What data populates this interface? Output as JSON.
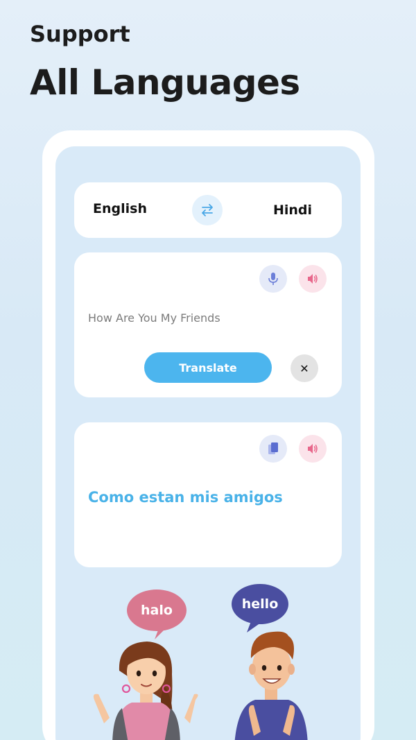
{
  "headline": {
    "subtitle": "Support",
    "title": "All Languages"
  },
  "language_selector": {
    "source": "English",
    "target": "Hindi",
    "swap_icon": "swap-arrows-icon"
  },
  "input_card": {
    "text": "How Are You My Friends",
    "mic_icon": "microphone-icon",
    "speaker_icon": "speaker-icon",
    "translate_label": "Translate",
    "clear_icon": "close-icon",
    "clear_glyph": "✕"
  },
  "output_card": {
    "text": "Como estan mis amigos",
    "copy_icon": "copy-icon",
    "speaker_icon": "speaker-icon"
  },
  "illustration": {
    "left_bubble": "halo",
    "right_bubble": "hello"
  },
  "colors": {
    "accent": "#4cb5ee",
    "output_text": "#49b2e8",
    "halo_bubble": "#d9788f",
    "hello_bubble": "#4a4ea0",
    "mic": "#6c7fd8",
    "speaker": "#e8678b"
  }
}
